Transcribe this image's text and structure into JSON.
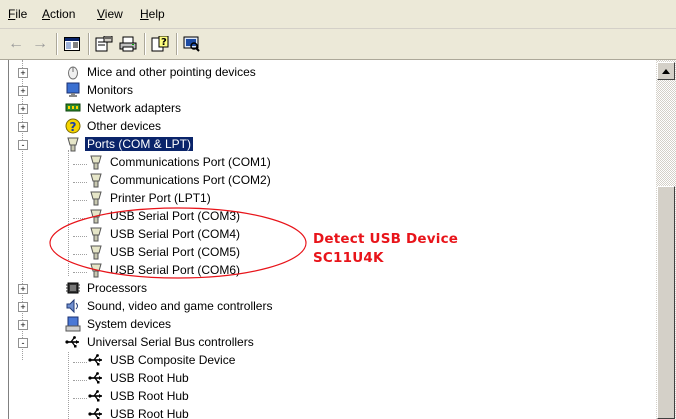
{
  "menu": {
    "file": {
      "accel": "F",
      "rest": "ile"
    },
    "action": {
      "accel": "A",
      "rest": "ction"
    },
    "view": {
      "accel": "V",
      "rest": "iew"
    },
    "help": {
      "accel": "H",
      "rest": "elp"
    }
  },
  "toolbar": {
    "icons": [
      "back-arrow-icon",
      "forward-arrow-icon",
      "console-tree-icon",
      "properties-icon",
      "print-icon",
      "help-icon",
      "scan-hardware-icon"
    ]
  },
  "tree": {
    "items": [
      {
        "label": "Mice and other pointing devices",
        "icon": "mouse-icon",
        "expander": "+"
      },
      {
        "label": "Monitors",
        "icon": "monitor-icon",
        "expander": "+"
      },
      {
        "label": "Network adapters",
        "icon": "network-adapter-icon",
        "expander": "+"
      },
      {
        "label": "Other devices",
        "icon": "unknown-device-icon",
        "expander": "+"
      },
      {
        "label": "Ports (COM & LPT)",
        "icon": "port-icon",
        "expander": "-",
        "selected": true
      },
      {
        "label": "Communications Port (COM1)",
        "icon": "port-icon"
      },
      {
        "label": "Communications Port (COM2)",
        "icon": "port-icon"
      },
      {
        "label": "Printer Port (LPT1)",
        "icon": "port-icon"
      },
      {
        "label": "USB Serial Port (COM3)",
        "icon": "port-icon"
      },
      {
        "label": "USB Serial Port (COM4)",
        "icon": "port-icon"
      },
      {
        "label": "USB Serial Port (COM5)",
        "icon": "port-icon"
      },
      {
        "label": "USB Serial Port (COM6)",
        "icon": "port-icon"
      },
      {
        "label": "Processors",
        "icon": "processor-icon",
        "expander": "+"
      },
      {
        "label": "Sound, video and game controllers",
        "icon": "sound-icon",
        "expander": "+"
      },
      {
        "label": "System devices",
        "icon": "system-device-icon",
        "expander": "+"
      },
      {
        "label": "Universal Serial Bus controllers",
        "icon": "usb-icon",
        "expander": "-"
      },
      {
        "label": "USB Composite Device",
        "icon": "usb-icon"
      },
      {
        "label": "USB Root Hub",
        "icon": "usb-icon"
      },
      {
        "label": "USB Root Hub",
        "icon": "usb-icon"
      },
      {
        "label": "USB Root Hub",
        "icon": "usb-icon"
      }
    ]
  },
  "annotation": {
    "line1": "Detect  USB Device",
    "line2": "SC11U4K",
    "color": "#e8141a"
  },
  "colors": {
    "selection": "#0a246a",
    "chrome": "#ece9d8"
  }
}
